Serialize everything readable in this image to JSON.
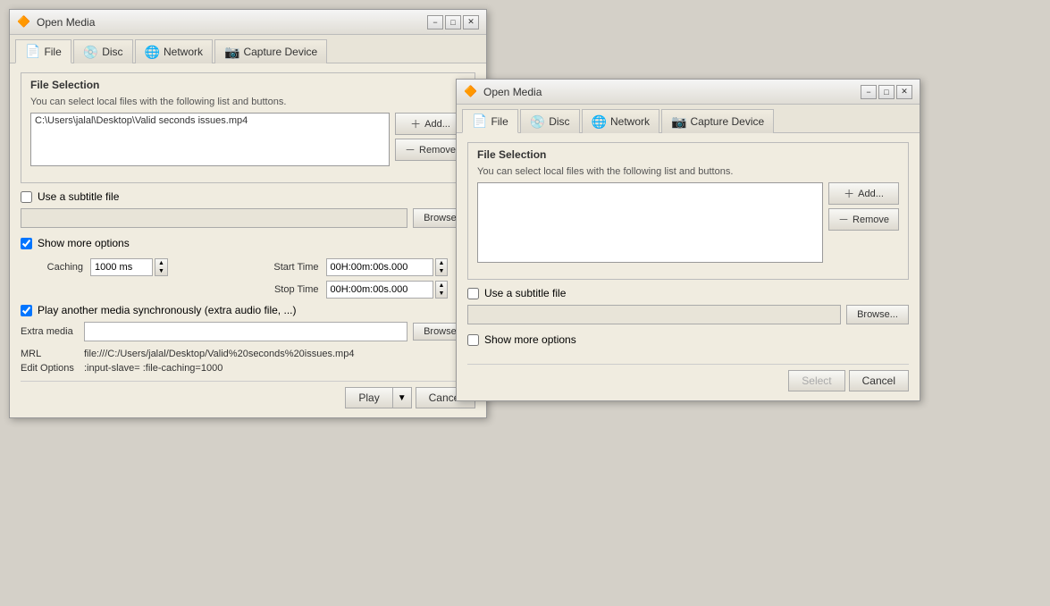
{
  "window1": {
    "title": "Open Media",
    "tabs": [
      {
        "id": "file",
        "label": "File",
        "icon": "📄",
        "active": true
      },
      {
        "id": "disc",
        "label": "Disc",
        "icon": "💿",
        "active": false
      },
      {
        "id": "network",
        "label": "Network",
        "icon": "🌐",
        "active": false
      },
      {
        "id": "capture",
        "label": "Capture Device",
        "icon": "📷",
        "active": false
      }
    ],
    "file_selection": {
      "title": "File Selection",
      "description": "You can select local files with the following list and buttons.",
      "file_path": "C:\\Users\\jalal\\Desktop\\Valid seconds issues.mp4",
      "add_label": "Add...",
      "remove_label": "Remove"
    },
    "subtitle": {
      "checkbox_label": "Use a subtitle file",
      "checked": false,
      "browse_label": "Browse..."
    },
    "show_more": {
      "label": "Show more options",
      "checked": true
    },
    "caching": {
      "label": "Caching",
      "value": "1000 ms"
    },
    "start_time": {
      "label": "Start Time",
      "value": "00H:00m:00s.000"
    },
    "stop_time": {
      "label": "Stop Time",
      "value": "00H:00m:00s.000"
    },
    "play_sync": {
      "label": "Play another media synchronously (extra audio file, ...)",
      "checked": true
    },
    "extra_media": {
      "label": "Extra media",
      "value": "",
      "browse_label": "Browse..."
    },
    "mrl": {
      "label": "MRL",
      "value": "file:///C:/Users/jalal/Desktop/Valid%20seconds%20issues.mp4"
    },
    "edit_options": {
      "label": "Edit Options",
      "value": ":input-slave= :file-caching=1000"
    },
    "buttons": {
      "play_label": "Play",
      "cancel_label": "Cancel"
    }
  },
  "window2": {
    "title": "Open Media",
    "tabs": [
      {
        "id": "file",
        "label": "File",
        "icon": "📄",
        "active": true
      },
      {
        "id": "disc",
        "label": "Disc",
        "icon": "💿",
        "active": false
      },
      {
        "id": "network",
        "label": "Network",
        "icon": "🌐",
        "active": false
      },
      {
        "id": "capture",
        "label": "Capture Device",
        "icon": "📷",
        "active": false
      }
    ],
    "file_selection": {
      "title": "File Selection",
      "description": "You can select local files with the following list and buttons.",
      "file_path": "",
      "add_label": "Add...",
      "remove_label": "Remove"
    },
    "subtitle": {
      "checkbox_label": "Use a subtitle file",
      "checked": false,
      "browse_label": "Browse..."
    },
    "show_more": {
      "label": "Show more options",
      "checked": false
    },
    "buttons": {
      "select_label": "Select",
      "cancel_label": "Cancel"
    }
  },
  "icons": {
    "vlc": "🔶",
    "minimize": "−",
    "maximize": "□",
    "close": "✕",
    "add": "+",
    "remove": "−"
  }
}
